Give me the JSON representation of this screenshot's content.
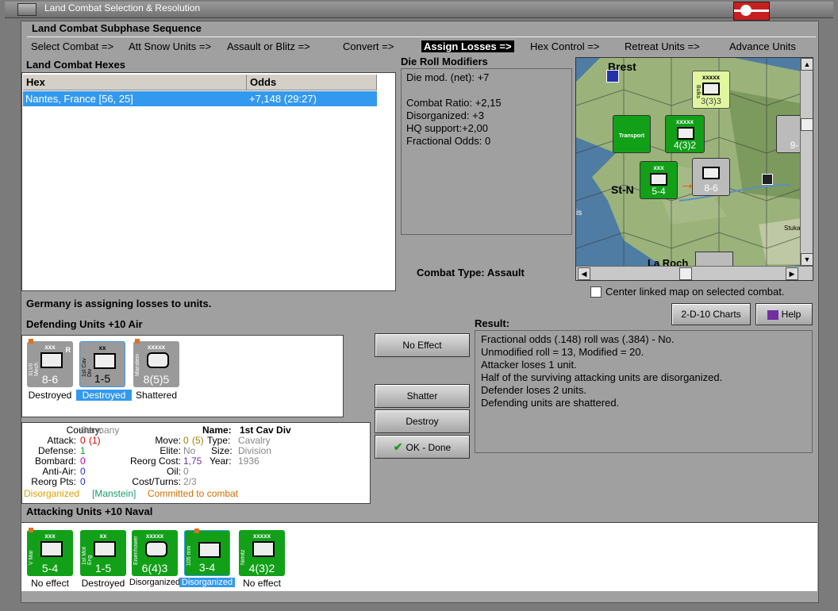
{
  "window": {
    "title": "Land Combat Selection & Resolution"
  },
  "subphase": {
    "title": "Land Combat Subphase Sequence",
    "phases": [
      "Select Combat =>",
      "Att Snow Units =>",
      "Assault or Blitz =>",
      "Convert =>",
      "Assign Losses =>",
      "Hex Control =>",
      "Retreat Units =>",
      "Advance Units"
    ],
    "active_index": 4
  },
  "hexes": {
    "title": "Land Combat Hexes",
    "columns": [
      "Hex",
      "Odds"
    ],
    "rows": [
      [
        "Nantes, France [56, 25]",
        "+7,148 (29:27)"
      ]
    ]
  },
  "die_roll": {
    "title": "Die Roll Modifiers",
    "lines": [
      "Die mod. (net): +7",
      "",
      "Combat Ratio: +2,15",
      "Disorganized: +3",
      "HQ support:+2,00",
      "Fractional Odds: 0"
    ]
  },
  "map": {
    "labels": [
      "Brest",
      "St-N",
      "La Roch",
      "Transport",
      "Bulks",
      "Stuka",
      "is"
    ],
    "units": [
      {
        "size": "xxxxx",
        "str": "3(3)3"
      },
      {
        "size": "xxxxx",
        "str": "4(3)2"
      },
      {
        "size": "xxx",
        "str": "5-4"
      },
      {
        "size": "",
        "str": "8-6"
      },
      {
        "size": "",
        "str": "9-"
      }
    ],
    "badges": [
      "2",
      "2",
      "3",
      "3",
      "0",
      "0",
      "3",
      "6",
      "2"
    ]
  },
  "combat_type": {
    "label": "Combat Type:",
    "value": "Assault"
  },
  "center_linked": {
    "label": "Center linked map on selected combat.",
    "checked": false
  },
  "buttons": {
    "charts": "2-D-10 Charts",
    "help": "Help",
    "no_effect": "No Effect",
    "shatter": "Shatter",
    "destroy": "Destroy",
    "ok_done": "OK - Done"
  },
  "assign_message": "Germany is assigning losses to units.",
  "defending": {
    "title": "Defending Units +10 Air",
    "units": [
      {
        "name": "XLVII Mech",
        "size": "xxx",
        "flag": "R",
        "str": "8-6",
        "label": "Destroyed",
        "color": "#9a9a9a",
        "selected": false
      },
      {
        "name": "1st Cav Div",
        "size": "xx",
        "flag": "",
        "str": "1-5",
        "label": "Destroyed",
        "color": "#9a9a9a",
        "selected": true
      },
      {
        "name": "Manstein",
        "size": "xxxxx",
        "flag": "",
        "str": "8(5)5",
        "label": "Shattered",
        "color": "#9a9a9a",
        "selected": false
      }
    ]
  },
  "result": {
    "title": "Result:",
    "lines": [
      "Fractional odds (.148) roll was (.384)  - No.",
      "Unmodified roll = 13, Modified = 20.",
      "Attacker loses 1 unit.",
      "Half of the surviving attacking units are disorganized.",
      "Defender loses 2 units.",
      "Defending units are shattered."
    ]
  },
  "info": {
    "country_label": "Country:",
    "country": "Germany",
    "name_label": "Name:",
    "name": "1st Cav Div",
    "attack_label": "Attack:",
    "attack": "0",
    "attack_paren": "(1)",
    "move_label": "Move:",
    "move": "0",
    "move_paren": "(5)",
    "type_label": "Type:",
    "type": "Cavalry",
    "defense_label": "Defense:",
    "defense": "1",
    "elite_label": "Elite:",
    "elite": "No",
    "size_label": "Size:",
    "size": "Division",
    "bombard_label": "Bombard:",
    "bombard": "0",
    "reorg_cost_label": "Reorg Cost:",
    "reorg_cost": "1,75",
    "year_label": "Year:",
    "year": "1936",
    "antiair_label": "Anti-Air:",
    "antiair": "0",
    "oil_label": "Oil:",
    "oil": "0",
    "reorg_pts_label": "Reorg Pts:",
    "reorg_pts": "0",
    "cost_turns_label": "Cost/Turns:",
    "cost_turns": "2/3",
    "status_disorg": "Disorganized",
    "status_hq": "[Manstein]",
    "status_committed": "Committed to combat"
  },
  "attacking": {
    "title": "Attacking Units +10 Naval",
    "units": [
      {
        "name": "V Mar",
        "size": "xxx",
        "str": "5-4",
        "label": "No effect",
        "selected": false
      },
      {
        "name": "1st Mot Eng",
        "size": "xx",
        "str": "1-5",
        "label": "Destroyed",
        "selected": false
      },
      {
        "name": "Eisenhower",
        "size": "xxxxx",
        "str": "6(4)3",
        "label": "Disorganized",
        "selected": false
      },
      {
        "name": "105 mm",
        "size": "",
        "str": "3-4",
        "label": "Disorganized",
        "selected": true
      },
      {
        "name": "Nimitz",
        "size": "xxxxx",
        "str": "4(3)2",
        "label": "No effect",
        "selected": false
      }
    ]
  },
  "colors": {
    "allied_green": "#12a019",
    "axis_gray": "#9a9a9a",
    "selection_blue": "#3399ee"
  }
}
